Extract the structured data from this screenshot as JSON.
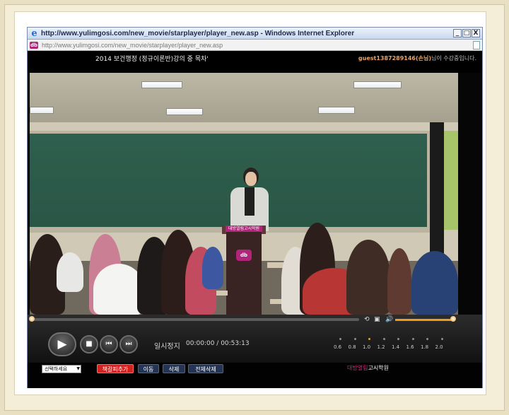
{
  "window": {
    "title": "http://www.yulimgosi.com/new_movie/starplayer/player_new.asp - Windows Internet Explorer",
    "address": "http://www.yulimgosi.com/new_movie/starplayer/player_new.asp",
    "controls": [
      "_",
      "□",
      "X"
    ]
  },
  "player": {
    "title": "2014 보건행정 (정규이론반)강의 중 목차'",
    "viewer_id": "guest1387289146(손님)",
    "viewer_message": "님이 수강중입니다.",
    "status": "일시정지",
    "time_current": "00:00:00",
    "time_total": "00:53:13",
    "progress": 0.0,
    "volume": 1.0,
    "speed_labels": [
      "0.6",
      "0.8",
      "1.0",
      "1.2",
      "1.4",
      "1.6",
      "1.8",
      "2.0"
    ],
    "speed_selected": "1.0",
    "podium_label": "대방열림고시학원",
    "podium_logo": "db"
  },
  "icons": {
    "browser": "ie-logo-icon",
    "site": "site-favicon-icon",
    "page": "page-icon",
    "play": "play-icon",
    "stop": "stop-icon",
    "prev": "previous-icon",
    "next": "next-icon",
    "repeat": "repeat-icon",
    "caption": "caption-icon",
    "volume": "volume-icon"
  },
  "bottom": {
    "select_value": "선택하세요",
    "buttons": [
      "책갈피추가",
      "이동",
      "삭제",
      "전체삭제"
    ],
    "brand_prefix": "대방열림",
    "brand_suffix": "고시학원"
  },
  "colors": {
    "accent": "#f09b1d",
    "brand": "#d52b78",
    "red_button": "#d22222",
    "blue_button": "#243454"
  }
}
